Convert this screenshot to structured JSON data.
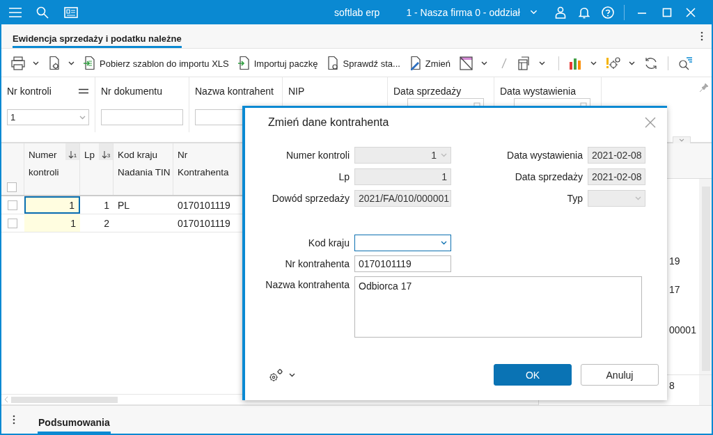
{
  "titlebar": {
    "app_name": "softlab erp",
    "company": "1 - Nasza firma 0 - oddział"
  },
  "tabs": [
    {
      "label": "Ewidencja sprzedaży i podatku należne",
      "selected": true
    }
  ],
  "toolbar": [
    {
      "label": "Pobierz szablon do importu XLS"
    },
    {
      "label": "Importuj paczkę"
    },
    {
      "label": "Sprawdź sta..."
    },
    {
      "label": "Zmień"
    }
  ],
  "filters": [
    {
      "kind": "select",
      "label": "Nr kontroli",
      "value": "1"
    },
    {
      "kind": "text",
      "label": "Nr dokumentu"
    },
    {
      "kind": "text",
      "label": "Nazwa kontrahent"
    },
    {
      "kind": "label",
      "label": "NIP"
    },
    {
      "kind": "date",
      "label": "Data sprzedaży"
    },
    {
      "kind": "date",
      "label": "Data wystawienia"
    }
  ],
  "grid": {
    "header_checked": false,
    "columns": [
      {
        "lines": [
          "Numer",
          "kontroli"
        ],
        "sort_rank": "1"
      },
      {
        "lines": [
          "Lp"
        ],
        "sort_rank": "3"
      },
      {
        "lines": [
          "Kod kraju",
          "Nadania TIN"
        ]
      },
      {
        "lines": [
          "Nr",
          "Kontrahenta"
        ]
      }
    ],
    "rows": [
      {
        "checked": false,
        "selected": true,
        "cells": [
          "1",
          "1",
          "PL",
          "0170101119"
        ]
      },
      {
        "checked": false,
        "selected": false,
        "cells": [
          "1",
          "2",
          null,
          "0170101119"
        ]
      }
    ]
  },
  "side_panel": {
    "fragments": [
      "19",
      "17",
      "00001",
      "8"
    ]
  },
  "bottom_tabs": [
    {
      "label": "Podsumowania",
      "selected": true
    }
  ],
  "dialog": {
    "title": "Zmień dane kontrahenta",
    "left_fields": [
      {
        "label": "Numer kontroli",
        "kind": "number_select",
        "value": "1",
        "disabled": true
      },
      {
        "label": "Lp",
        "kind": "number",
        "value": "1",
        "disabled": true
      },
      {
        "label": "Dowód sprzedaży",
        "kind": "text",
        "value": "2021/FA/010/000001",
        "disabled": true
      }
    ],
    "right_fields": [
      {
        "label": "Data wystawienia",
        "kind": "date",
        "value": "2021-02-08",
        "disabled": true
      },
      {
        "label": "Data sprzedaży",
        "kind": "date",
        "value": "2021-02-08",
        "disabled": true
      },
      {
        "label": "Typ",
        "kind": "select",
        "disabled": true
      }
    ],
    "contractor_fields": [
      {
        "label": "Kod kraju",
        "kind": "select",
        "disabled": false,
        "focused": true
      },
      {
        "label": "Nr kontrahenta",
        "kind": "text",
        "value": "0170101119",
        "disabled": false,
        "focused": false
      },
      {
        "label": "Nazwa kontrahenta",
        "kind": "textarea",
        "value": "Odbiorca 17",
        "disabled": false,
        "focused": false
      }
    ],
    "buttons": [
      {
        "label": "OK",
        "primary": true
      },
      {
        "label": "Anuluj",
        "primary": false
      }
    ]
  }
}
